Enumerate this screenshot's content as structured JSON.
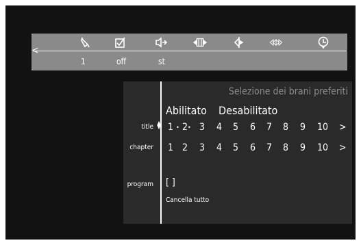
{
  "menubar": {
    "back_icon": "left-arrow-icon",
    "tools": [
      {
        "name": "angle-icon",
        "value": "1"
      },
      {
        "name": "subtitle-icon",
        "value": "off"
      },
      {
        "name": "audio-icon",
        "value": "st"
      },
      {
        "name": "segment-icon",
        "value": ""
      },
      {
        "name": "bookmark-icon",
        "value": ""
      },
      {
        "name": "shuttle-icon",
        "value": ""
      },
      {
        "name": "time-icon",
        "value": ""
      }
    ]
  },
  "panel": {
    "heading": "Selezione dei brani preferiti",
    "enabled_label": "Abilitato",
    "disabled_label": "Desabilitato",
    "title_label": "title",
    "chapter_label": "chapter",
    "program_label": "program",
    "title_numbers": [
      "1",
      "2",
      "3",
      "4",
      "5",
      "6",
      "7",
      "8",
      "9",
      "10"
    ],
    "chapter_numbers": [
      "1",
      "2",
      "3",
      "4",
      "5",
      "6",
      "7",
      "8",
      "9",
      "10"
    ],
    "more_symbol": ">",
    "program_value": "[ ]",
    "clear_all": "Cancella tutto"
  },
  "colors": {
    "background": "#121212",
    "menubar": "#8a8a8a",
    "panel": "#2a2a2a",
    "heading": "#8c8c8c",
    "text": "#ffffff"
  }
}
